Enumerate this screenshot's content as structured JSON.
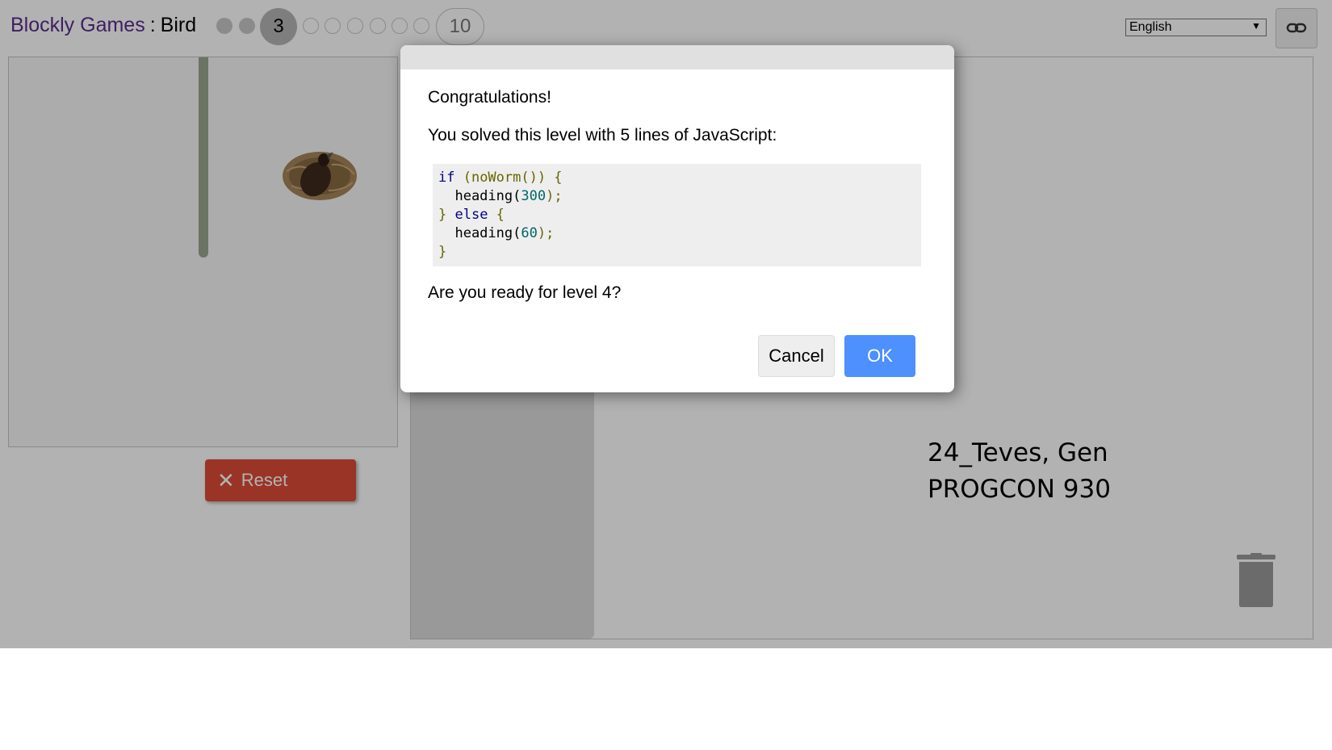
{
  "header": {
    "games_link": "Blockly Games",
    "separator": ":",
    "game_name": "Bird",
    "current_level": "3",
    "last_level": "10",
    "completed_levels": 2,
    "language": "English"
  },
  "reset_label": "Reset",
  "caption": {
    "line1": "24_Teves, Gen",
    "line2": "PROGCON 930"
  },
  "dialog": {
    "title": "Congratulations!",
    "message": "You solved this level with 5 lines of JavaScript:",
    "code": {
      "l1_kw": "if",
      "l1_rest": " (noWorm()) {",
      "l2_fn": "  heading(",
      "l2_num": "300",
      "l2_end": ");",
      "l3_a": "} ",
      "l3_kw": "else",
      "l3_b": " {",
      "l4_fn": "  heading(",
      "l4_num": "60",
      "l4_end": ");",
      "l5": "}"
    },
    "question": "Are you ready for level 4?",
    "cancel_label": "Cancel",
    "ok_label": "OK"
  },
  "colors": {
    "link": "#5b2d8e",
    "reset": "#dd4b39",
    "ok": "#4d90fe",
    "wall": "#9aa58d"
  },
  "icons": [
    "link-icon",
    "close-icon",
    "trash-icon",
    "nest-with-bird-icon"
  ]
}
